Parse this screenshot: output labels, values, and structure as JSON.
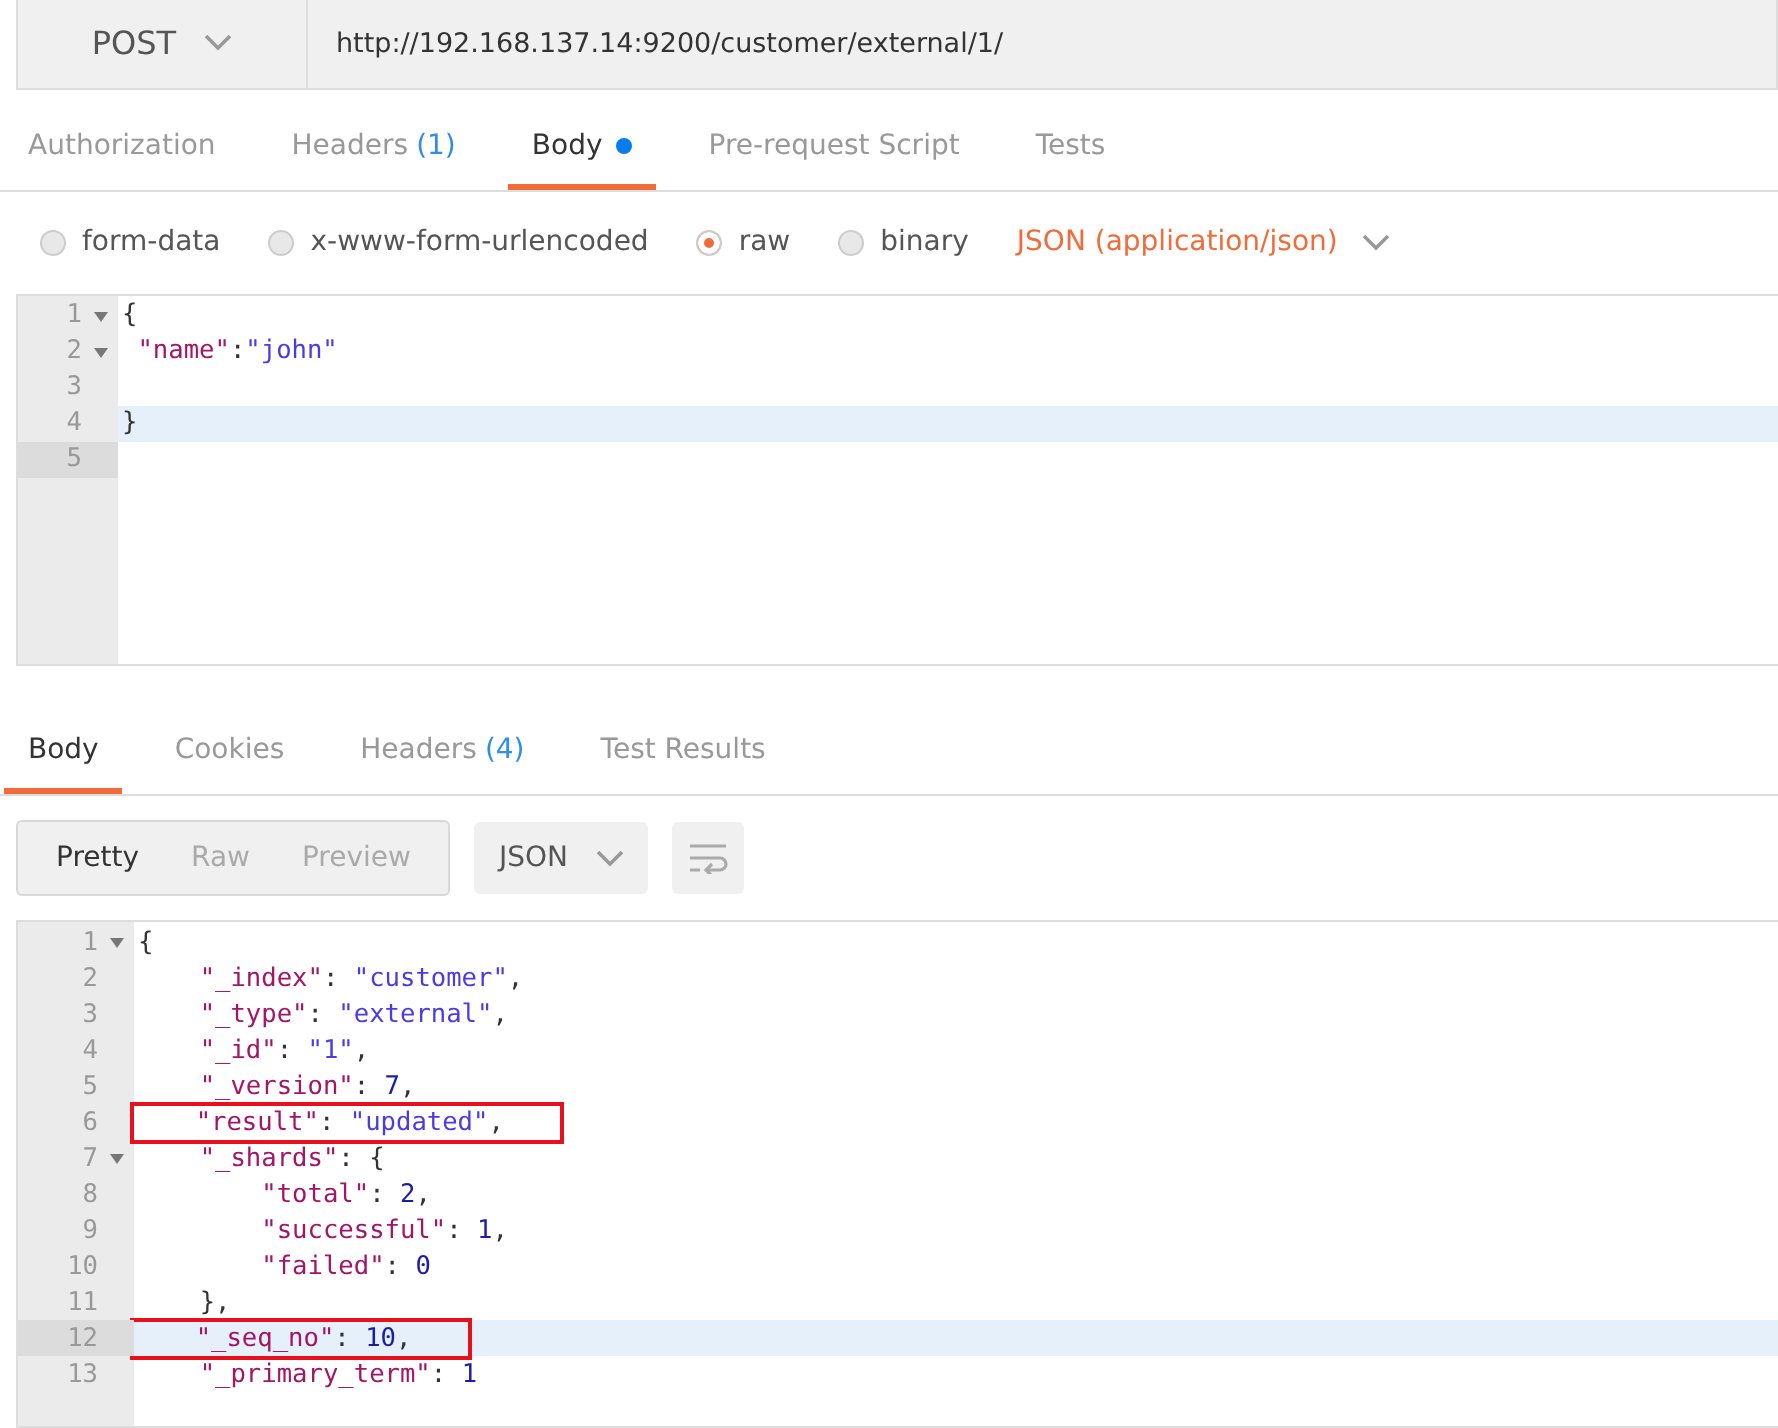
{
  "request": {
    "method": "POST",
    "url": "http://192.168.137.14:9200/customer/external/1/"
  },
  "request_tabs": [
    {
      "label": "Authorization",
      "selected": false
    },
    {
      "label": "Headers",
      "count": "(1)",
      "selected": false
    },
    {
      "label": "Body",
      "selected": true,
      "dot": true
    },
    {
      "label": "Pre-request Script",
      "selected": false
    },
    {
      "label": "Tests",
      "selected": false
    }
  ],
  "body_types": [
    {
      "label": "form-data",
      "selected": false
    },
    {
      "label": "x-www-form-urlencoded",
      "selected": false
    },
    {
      "label": "raw",
      "selected": true
    },
    {
      "label": "binary",
      "selected": false
    }
  ],
  "content_type": "JSON (application/json)",
  "request_editor": {
    "lines": [
      {
        "number": "1",
        "foldable": true,
        "active": false,
        "current": false,
        "tokens": [
          {
            "kind": "punct",
            "text": "{"
          }
        ]
      },
      {
        "number": "2",
        "foldable": true,
        "active": false,
        "current": false,
        "tokens": [
          {
            "kind": "key",
            "text": " \"name\""
          },
          {
            "kind": "punct",
            "text": ":"
          },
          {
            "kind": "string",
            "text": "\"john\""
          }
        ]
      },
      {
        "number": "3",
        "foldable": false,
        "active": false,
        "current": false
      },
      {
        "number": "4",
        "foldable": false,
        "active": true,
        "current": false,
        "tokens": [
          {
            "kind": "punct",
            "text": "}"
          }
        ]
      },
      {
        "number": "5",
        "foldable": false,
        "active": false,
        "current": true
      }
    ]
  },
  "response_tabs": [
    {
      "label": "Body",
      "selected": true
    },
    {
      "label": "Cookies",
      "selected": false
    },
    {
      "label": "Headers",
      "count": "(4)",
      "selected": false
    },
    {
      "label": "Test Results",
      "selected": false
    }
  ],
  "view_modes": [
    {
      "label": "Pretty",
      "selected": true
    },
    {
      "label": "Raw",
      "selected": false
    },
    {
      "label": "Preview",
      "selected": false
    }
  ],
  "format": "JSON",
  "response_editor": {
    "lines": [
      {
        "number": "1",
        "foldable": true,
        "active": false,
        "current": false,
        "boxed": false,
        "tokens": [
          {
            "kind": "punct",
            "text": "{"
          }
        ]
      },
      {
        "number": "2",
        "foldable": false,
        "active": false,
        "current": false,
        "boxed": false,
        "tokens": [
          {
            "kind": "key",
            "text": "    \"_index\""
          },
          {
            "kind": "punct",
            "text": ": "
          },
          {
            "kind": "string",
            "text": "\"customer\""
          },
          {
            "kind": "punct",
            "text": ","
          }
        ]
      },
      {
        "number": "3",
        "foldable": false,
        "active": false,
        "current": false,
        "boxed": false,
        "tokens": [
          {
            "kind": "key",
            "text": "    \"_type\""
          },
          {
            "kind": "punct",
            "text": ": "
          },
          {
            "kind": "string",
            "text": "\"external\""
          },
          {
            "kind": "punct",
            "text": ","
          }
        ]
      },
      {
        "number": "4",
        "foldable": false,
        "active": false,
        "current": false,
        "boxed": false,
        "tokens": [
          {
            "kind": "key",
            "text": "    \"_id\""
          },
          {
            "kind": "punct",
            "text": ": "
          },
          {
            "kind": "string",
            "text": "\"1\""
          },
          {
            "kind": "punct",
            "text": ","
          }
        ]
      },
      {
        "number": "5",
        "foldable": false,
        "active": false,
        "current": false,
        "boxed": false,
        "tokens": [
          {
            "kind": "key",
            "text": "    \"_version\""
          },
          {
            "kind": "punct",
            "text": ": "
          },
          {
            "kind": "number",
            "text": "7"
          },
          {
            "kind": "punct",
            "text": ","
          }
        ]
      },
      {
        "number": "6",
        "foldable": false,
        "active": false,
        "current": false,
        "boxed": true,
        "tokens": [
          {
            "kind": "key",
            "text": "    \"result\""
          },
          {
            "kind": "punct",
            "text": ": "
          },
          {
            "kind": "string",
            "text": "\"updated\""
          },
          {
            "kind": "punct",
            "text": ","
          }
        ]
      },
      {
        "number": "7",
        "foldable": true,
        "active": false,
        "current": false,
        "boxed": false,
        "tokens": [
          {
            "kind": "key",
            "text": "    \"_shards\""
          },
          {
            "kind": "punct",
            "text": ": {"
          }
        ]
      },
      {
        "number": "8",
        "foldable": false,
        "active": false,
        "current": false,
        "boxed": false,
        "tokens": [
          {
            "kind": "key",
            "text": "        \"total\""
          },
          {
            "kind": "punct",
            "text": ": "
          },
          {
            "kind": "number",
            "text": "2"
          },
          {
            "kind": "punct",
            "text": ","
          }
        ]
      },
      {
        "number": "9",
        "foldable": false,
        "active": false,
        "current": false,
        "boxed": false,
        "tokens": [
          {
            "kind": "key",
            "text": "        \"successful\""
          },
          {
            "kind": "punct",
            "text": ": "
          },
          {
            "kind": "number",
            "text": "1"
          },
          {
            "kind": "punct",
            "text": ","
          }
        ]
      },
      {
        "number": "10",
        "foldable": false,
        "active": false,
        "current": false,
        "boxed": false,
        "tokens": [
          {
            "kind": "key",
            "text": "        \"failed\""
          },
          {
            "kind": "punct",
            "text": ": "
          },
          {
            "kind": "number",
            "text": "0"
          }
        ]
      },
      {
        "number": "11",
        "foldable": false,
        "active": false,
        "current": false,
        "boxed": false,
        "tokens": [
          {
            "kind": "punct",
            "text": "    },"
          }
        ]
      },
      {
        "number": "12",
        "foldable": false,
        "active": true,
        "current": true,
        "boxed": true,
        "tokens": [
          {
            "kind": "key",
            "text": "    \"_seq_no\""
          },
          {
            "kind": "punct",
            "text": ": "
          },
          {
            "kind": "number",
            "text": "10"
          },
          {
            "kind": "punct",
            "text": ","
          }
        ]
      },
      {
        "number": "13",
        "foldable": false,
        "active": false,
        "current": false,
        "boxed": false,
        "tokens": [
          {
            "kind": "key",
            "text": "    \"_primary_term\""
          },
          {
            "kind": "punct",
            "text": ": "
          },
          {
            "kind": "number",
            "text": "1"
          }
        ]
      }
    ]
  }
}
